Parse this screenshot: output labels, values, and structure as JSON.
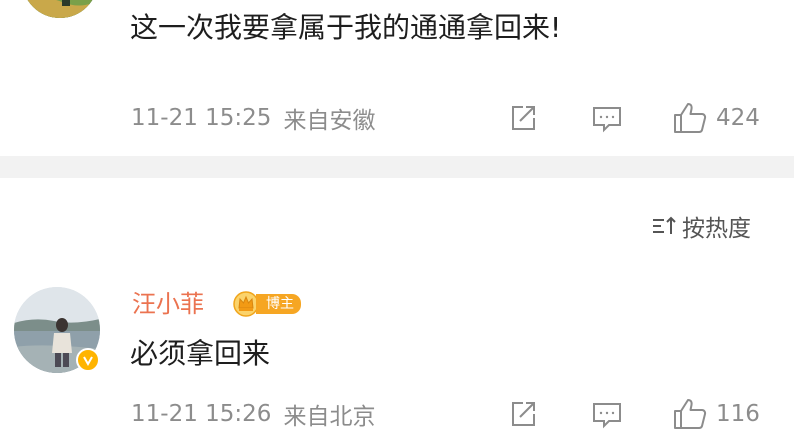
{
  "comments": [
    {
      "text": "这一次我要拿属于我的通通拿回来!",
      "time": "11-21 15:25",
      "location": "来自安徽",
      "likes": "424"
    },
    {
      "username": "汪小菲",
      "badge": "博主",
      "text": "必须拿回来",
      "time": "11-21 15:26",
      "location": "来自北京",
      "likes": "116"
    }
  ],
  "sort": {
    "label": "按热度"
  },
  "icons": {
    "share": "share-icon",
    "comment": "comment-icon",
    "like": "thumbs-up-icon",
    "sort": "sort-icon",
    "verified": "verified-badge-icon"
  },
  "colors": {
    "username": "#eb7350",
    "meta": "#8c8c8c",
    "badge": "#f6a623",
    "divider": "#f2f2f2"
  }
}
